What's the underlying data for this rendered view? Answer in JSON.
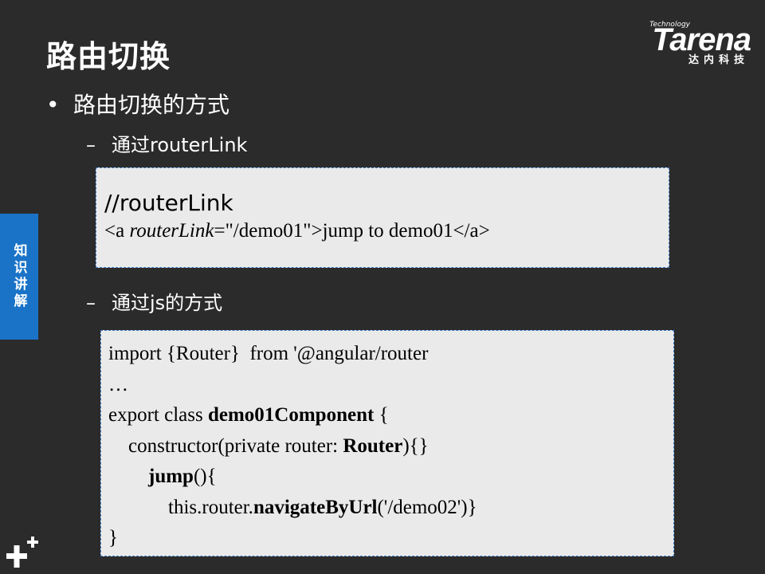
{
  "title": "路由切换",
  "logo": {
    "tech": "Technology",
    "word": "Tarena",
    "cn": "达内科技"
  },
  "side_tab": "知识讲解",
  "bullet": {
    "marker": "•",
    "text": "路由切换的方式"
  },
  "sub1": {
    "marker": "–",
    "text": "通过routerLink"
  },
  "sub2": {
    "marker": "–",
    "text": "通过js的方式"
  },
  "box1": {
    "comment": "//routerLink",
    "line_a": "<a ",
    "line_b": "routerLink",
    "line_c": "=\"/demo01\">jump  to demo01</a>"
  },
  "box2": {
    "l1": "import {Router}  from '@angular/router",
    "l2": "…",
    "l3a": "export class ",
    "l3b": "demo01Component",
    "l3c": " {",
    "l4a": "    constructor(private router: ",
    "l4b": "Router",
    "l4c": "){}",
    "l5a": "        ",
    "l5b": "jump",
    "l5c": "(){",
    "l6a": "            this.router.",
    "l6b": "navigateByUrl",
    "l6c": "('/demo02')}",
    "l7": "}"
  }
}
